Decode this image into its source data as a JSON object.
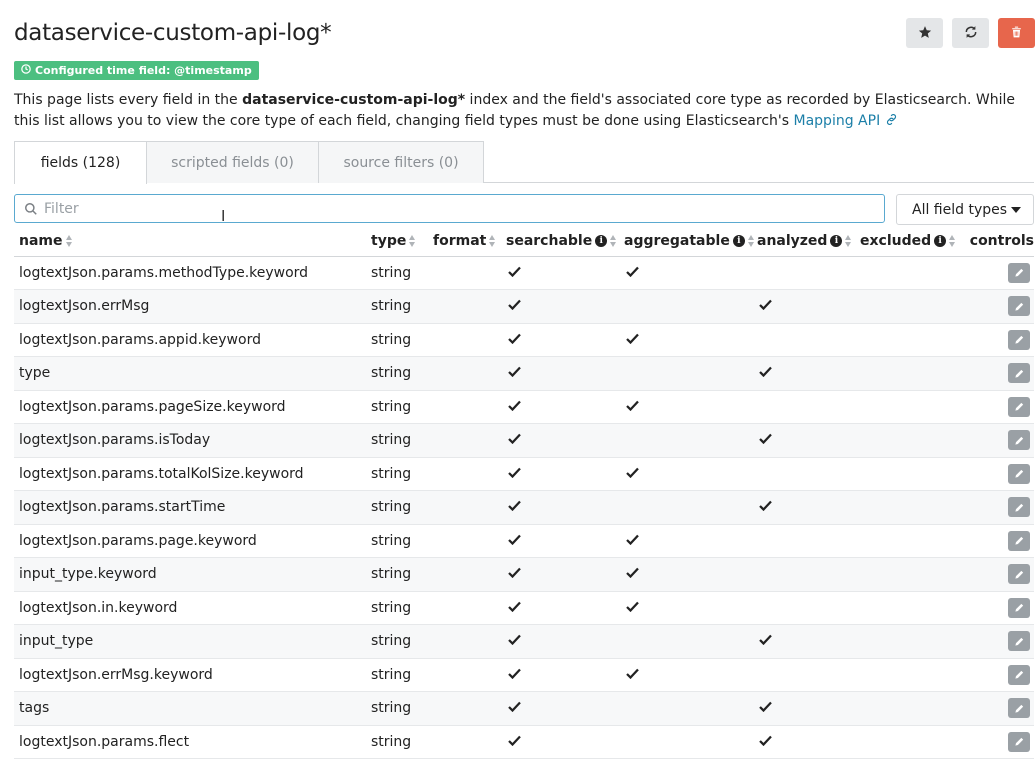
{
  "page": {
    "title": "dataservice-custom-api-log*",
    "badge": "Configured time field: @timestamp",
    "description": {
      "part1": "This page lists every field in the ",
      "index_name": "dataservice-custom-api-log*",
      "part2": " index and the field's associated core type as recorded by Elasticsearch. While this list allows you to view the core type of each field, changing field types must be done using Elasticsearch's ",
      "link": "Mapping API"
    }
  },
  "header_buttons": {
    "favorite_icon": "star-icon",
    "refresh_icon": "refresh-icon",
    "delete_icon": "trash-icon",
    "delete_color": "#e7664c"
  },
  "tabs": [
    {
      "label": "fields (128)",
      "active": true
    },
    {
      "label": "scripted fields (0)",
      "active": false
    },
    {
      "label": "source filters (0)",
      "active": false
    }
  ],
  "filter": {
    "placeholder": "Filter",
    "value": ""
  },
  "type_select": {
    "selected": "All field types"
  },
  "table": {
    "columns": {
      "name": "name",
      "type": "type",
      "format": "format",
      "searchable": "searchable",
      "aggregatable": "aggregatable",
      "analyzed": "analyzed",
      "excluded": "excluded",
      "controls": "controls"
    },
    "rows": [
      {
        "name": "logtextJson.params.methodType.keyword",
        "type": "string",
        "searchable": true,
        "aggregatable": true,
        "analyzed": false,
        "excluded": false
      },
      {
        "name": "logtextJson.errMsg",
        "type": "string",
        "searchable": true,
        "aggregatable": false,
        "analyzed": true,
        "excluded": false
      },
      {
        "name": "logtextJson.params.appid.keyword",
        "type": "string",
        "searchable": true,
        "aggregatable": true,
        "analyzed": false,
        "excluded": false
      },
      {
        "name": "type",
        "type": "string",
        "searchable": true,
        "aggregatable": false,
        "analyzed": true,
        "excluded": false
      },
      {
        "name": "logtextJson.params.pageSize.keyword",
        "type": "string",
        "searchable": true,
        "aggregatable": true,
        "analyzed": false,
        "excluded": false
      },
      {
        "name": "logtextJson.params.isToday",
        "type": "string",
        "searchable": true,
        "aggregatable": false,
        "analyzed": true,
        "excluded": false
      },
      {
        "name": "logtextJson.params.totalKolSize.keyword",
        "type": "string",
        "searchable": true,
        "aggregatable": true,
        "analyzed": false,
        "excluded": false
      },
      {
        "name": "logtextJson.params.startTime",
        "type": "string",
        "searchable": true,
        "aggregatable": false,
        "analyzed": true,
        "excluded": false
      },
      {
        "name": "logtextJson.params.page.keyword",
        "type": "string",
        "searchable": true,
        "aggregatable": true,
        "analyzed": false,
        "excluded": false
      },
      {
        "name": "input_type.keyword",
        "type": "string",
        "searchable": true,
        "aggregatable": true,
        "analyzed": false,
        "excluded": false
      },
      {
        "name": "logtextJson.in.keyword",
        "type": "string",
        "searchable": true,
        "aggregatable": true,
        "analyzed": false,
        "excluded": false
      },
      {
        "name": "input_type",
        "type": "string",
        "searchable": true,
        "aggregatable": false,
        "analyzed": true,
        "excluded": false
      },
      {
        "name": "logtextJson.errMsg.keyword",
        "type": "string",
        "searchable": true,
        "aggregatable": true,
        "analyzed": false,
        "excluded": false
      },
      {
        "name": "tags",
        "type": "string",
        "searchable": true,
        "aggregatable": false,
        "analyzed": true,
        "excluded": false
      },
      {
        "name": "logtextJson.params.flect",
        "type": "string",
        "searchable": true,
        "aggregatable": false,
        "analyzed": true,
        "excluded": false
      }
    ]
  },
  "colors": {
    "badge": "#4cbf80",
    "link": "#1c7fa8",
    "filter_border": "#5aa9d0"
  }
}
